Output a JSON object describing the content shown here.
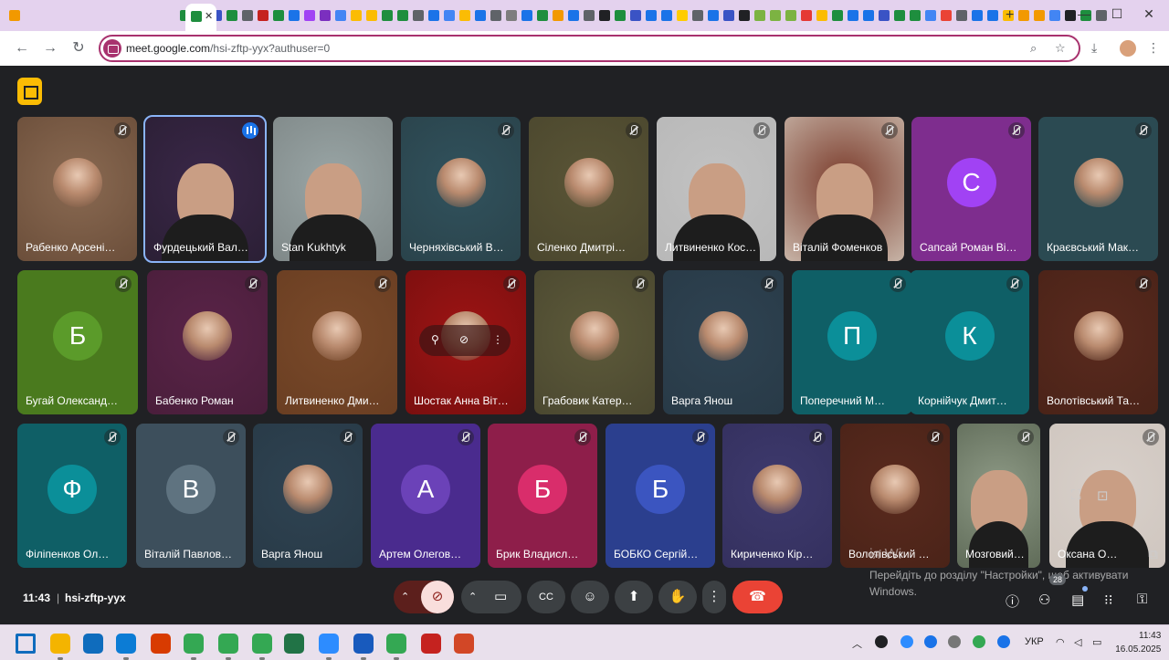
{
  "browser": {
    "tab_title": "",
    "tab_close": "✕",
    "new_tab": "+",
    "url_domain": "meet.google.com",
    "url_path": "/hsi-zftp-yyx?authuser=0",
    "favicon_colors": [
      "#f29900",
      "#1e8e3e",
      "#1a73e8",
      "#3a53c5",
      "#1e8e3e",
      "#5f6368",
      "#c5221f",
      "#1e8e3e",
      "#1a73e8",
      "#a142f4",
      "#7b2fbf",
      "#4285f4",
      "#fbbc04",
      "#fbbc04",
      "#1e8e3e",
      "#1e8e3e",
      "#5f6368",
      "#1a73e8",
      "#4285f4",
      "#fbbc04",
      "#1a73e8",
      "#5f6368",
      "#7d7d7d",
      "#1a73e8",
      "#1e8e3e",
      "#f29900",
      "#1a73e8",
      "#5f6368",
      "#202124",
      "#1e8e3e",
      "#3a53c5",
      "#1a73e8",
      "#1a73e8",
      "#ffcc00",
      "#5f6368",
      "#1a73e8",
      "#3a53c5",
      "#202124",
      "#7cb342",
      "#7cb342",
      "#7cb342",
      "#e53935",
      "#fbbc04",
      "#1e8e3e",
      "#1a73e8",
      "#1a73e8",
      "#3a53c5",
      "#1e8e3e",
      "#1e8e3e",
      "#4285f4",
      "#ea4335",
      "#5f6368",
      "#1a73e8",
      "#1a73e8",
      "#fbbc04",
      "#f29900",
      "#f29900",
      "#4285f4",
      "#202124",
      "#1e8e3e",
      "#5f6368"
    ]
  },
  "meet": {
    "time": "11:43",
    "separator": "|",
    "meeting_code": "hsi-zftp-yyx",
    "people_count": "28",
    "windows_watermark": {
      "title": "ія Wi",
      "line1": "Перейдіть до розділу \"Настройки\", щоб активувати",
      "line2": "Windows."
    },
    "participants": [
      {
        "name": "Рабенко Арсені…",
        "kind": "pic",
        "color": "#8a6a52",
        "bg": "#6b4e3a"
      },
      {
        "name": "Фурдецький Вал…",
        "kind": "video",
        "color": "#3a2748",
        "bg": "#2b1f35"
      },
      {
        "name": "Stan Kukhtyk",
        "kind": "video",
        "color": "#9aa6a6",
        "bg": "#7f8888"
      },
      {
        "name": "Черняхівський В…",
        "kind": "pic",
        "color": "#31525d",
        "bg": "#2a434b"
      },
      {
        "name": "Сіленко Дмитрі…",
        "kind": "pic",
        "color": "#5a5536",
        "bg": "#4b472e"
      },
      {
        "name": "Литвиненко Кос…",
        "kind": "video",
        "color": "#c2c2c2",
        "bg": "#b8b8b8"
      },
      {
        "name": "Віталій Фоменков",
        "kind": "video",
        "color": "#7a3a2a",
        "bg": "#c7b4a7"
      },
      {
        "name": "Сапсай Роман Ві…",
        "kind": "letter",
        "letter": "С",
        "color": "#7e2d8e",
        "accent": "#a142f4"
      },
      {
        "name": "Краєвський Мак…",
        "kind": "pic",
        "color": "#2b4a52",
        "bg": "#2b4a52"
      },
      {
        "name": "Бугай Олександ…",
        "kind": "letter",
        "letter": "Б",
        "color": "#4a7a1e",
        "accent": "#5b9b2a"
      },
      {
        "name": "Бабенко Роман",
        "kind": "pic",
        "color": "#5a2448",
        "bg": "#4a1e3b"
      },
      {
        "name": "Литвиненко Дми…",
        "kind": "pic",
        "color": "#7a4a2a",
        "bg": "#6a3e22"
      },
      {
        "name": "Шостак Анна Віт…",
        "kind": "hover",
        "color": "#9e1414",
        "bg": "#7a0f0f"
      },
      {
        "name": "Грабовик Катер…",
        "kind": "pic",
        "color": "#5d5a3a",
        "bg": "#4b4830"
      },
      {
        "name": "Варга Янош",
        "kind": "pic",
        "color": "#2f4352",
        "bg": "#283a47"
      },
      {
        "name": "Поперечний М…",
        "kind": "letter",
        "letter": "П",
        "color": "#0f5f66",
        "accent": "#0b8f99"
      },
      {
        "name": "Корнійчук Дмит…",
        "kind": "letter",
        "letter": "К",
        "color": "#0f5f66",
        "accent": "#0b8f99"
      },
      {
        "name": "Волотівський Та…",
        "kind": "pic",
        "color": "#5a2a1e",
        "bg": "#4a2318"
      },
      {
        "name": "Філіпенков Ол…",
        "kind": "letter",
        "letter": "Ф",
        "color": "#0f5f66",
        "accent": "#0b8f99"
      },
      {
        "name": "Віталій Павлов…",
        "kind": "letter",
        "letter": "В",
        "color": "#3d4f5c",
        "accent": "#5f7380"
      },
      {
        "name": "Варга Янош",
        "kind": "pic",
        "color": "#2f4352",
        "bg": "#283a47"
      },
      {
        "name": "Артем Олегов…",
        "kind": "letter",
        "letter": "А",
        "color": "#4a2b8e",
        "accent": "#6b42b8"
      },
      {
        "name": "Брик Владисл…",
        "kind": "letter",
        "letter": "Б",
        "color": "#8e1e4a",
        "accent": "#d92d6b"
      },
      {
        "name": "БОБКО Сергій…",
        "kind": "letter",
        "letter": "Б",
        "color": "#2b3f8e",
        "accent": "#3b55c0"
      },
      {
        "name": "Кириченко Кір…",
        "kind": "pic",
        "color": "#3e3a6e",
        "bg": "#34305e"
      },
      {
        "name": "Волотівський …",
        "kind": "pic",
        "color": "#5a2a1e",
        "bg": "#4a2318"
      },
      {
        "name": "Мозговий…",
        "kind": "video",
        "color": "#8e9a86",
        "bg": "#5f6b58"
      },
      {
        "name": "Оксана О…",
        "kind": "video",
        "color": "#d8d0ca",
        "bg": "#cfc6bf"
      }
    ],
    "controls": {
      "expand_up": "⌃",
      "mic_icon": "mic-off",
      "camera_icon": "video",
      "captions_icon": "CC",
      "emoji_icon": "☺",
      "present_icon": "⬆",
      "hand_icon": "✋",
      "more_icon": "⋮",
      "hangup_icon": "☎",
      "info_icon": "ⓘ",
      "people_icon": "👥",
      "chat_icon": "💬",
      "activities_icon": "⋯",
      "host_icon": "🔒"
    }
  },
  "taskbar": {
    "language": "УКР",
    "time": "11:43",
    "date": "16.05.2025",
    "apps": [
      "#1a73e8",
      "#f4b400",
      "#0f6cbd",
      "#0c7cd5",
      "#d83b01",
      "#34a853",
      "#34a853",
      "#34a853",
      "#217346",
      "#2d8cff",
      "#185abd",
      "#34a853",
      "#c5221f",
      "#d24726"
    ]
  }
}
